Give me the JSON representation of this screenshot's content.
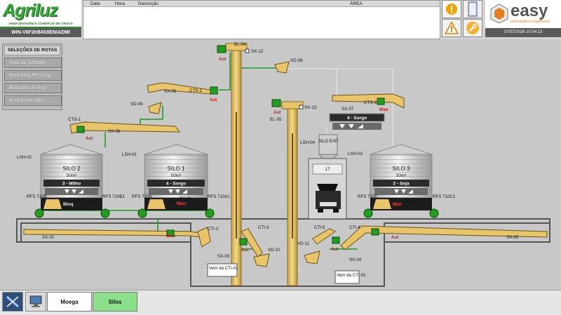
{
  "header": {
    "logo": "Agriluz",
    "logo_sub": "ARMAZENAGEM E COMÉRCIO DE GRÃOS",
    "station": "WIN-V6F2H84S8EN\\ADMI",
    "alarm_columns": [
      "Data",
      "Hora",
      "Descrição",
      "ÁREA"
    ],
    "easy_logo": "easy",
    "easy_sub": "automação e engenharia",
    "datetime": "07/07/2026 10:54:13"
  },
  "routes": {
    "title": "SELEÇÕES DE ROTAS",
    "items": [
      "Rota do Secador",
      "Rota Máq Pré Limp",
      "Rota Silo de Exp",
      "Rota Entre Silos"
    ]
  },
  "silos": [
    {
      "name": "SILO 2",
      "capacity": "50m³",
      "product": "3 - Milho",
      "rv": "RV-02",
      "status": "Bloq",
      "rfs_left": "RFS 710B",
      "rfs_right": "RFS 710B1",
      "lsh": "LSH-02"
    },
    {
      "name": "SILO 1",
      "capacity": "50m³",
      "product": "4 - Sorgo",
      "rv": "RV-01",
      "status": "Man",
      "rfs_left": "RFS 710A",
      "rfs_right": "RFS 710A1",
      "lsh": "LSH-01"
    },
    {
      "name": "SILO 3",
      "capacity": "50m³",
      "product": "2 - Soja",
      "rv": "RV-03",
      "status": "Man",
      "rfs_left": "RFS 710C",
      "rfs_right": "RFS 710C1",
      "lsh": "LSH-03"
    }
  ],
  "silo_exp": {
    "name": "SILO EXP",
    "lsh": "LSH-04",
    "value": "17"
  },
  "displays": {
    "top_right": "4 - Sorgo"
  },
  "equipment": {
    "el04": "EL-04",
    "el05": "EL-05",
    "sx12": "SX-12",
    "sx13": "SX-13",
    "sx06": "SX-06",
    "sx08": "SX-08",
    "sx07": "SX-07",
    "sx02": "SX-02",
    "sx03": "SX-03",
    "sx04": "SX-04",
    "sx05": "SX-05",
    "vd08": "VD-08",
    "vd09": "VD-09",
    "vd10": "VD-10",
    "vd11": "VD-11",
    "cts1": "CTS-1",
    "cts2": "CTS-2",
    "cts3": "CTS-3",
    "cti1": "CTI-1",
    "cti2": "CTI-2",
    "cti3": "CTI-3",
    "cti4": "CTI-4",
    "cti5": "CTI-5",
    "vem1": "Vem da CTI-01",
    "vem2": "Vem da CTI-01",
    "aut": "Aut",
    "man": "Man"
  },
  "footer": {
    "moega": "Moega",
    "silos": "Silos"
  },
  "colors": {
    "accent_green": "#8be08b",
    "running": "#1f9e1f",
    "alarm_red": "#d01818",
    "conveyor": "#e8c46a"
  }
}
